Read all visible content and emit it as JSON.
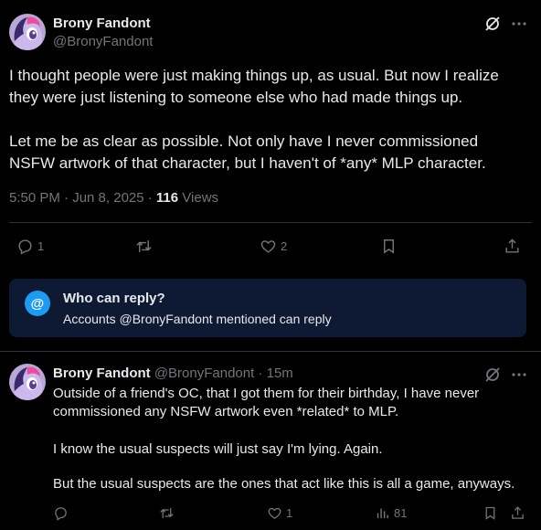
{
  "tweet": {
    "author": "Brony Fandont",
    "handle": "@BronyFandont",
    "paragraph1": "I thought people were just making things up, as usual. But now I realize they were just listening to someone else who had made things up.",
    "paragraph2": "Let me be as clear as possible. Not only have I never commissioned NSFW artwork of that character, but I haven't of *any* MLP character.",
    "time": "5:50 PM · Jun 8, 2025 · ",
    "views_count": "116",
    "views_label": " Views",
    "replies": "1",
    "likes": "2"
  },
  "who_can_reply": {
    "at_symbol": "@",
    "title": "Who can reply?",
    "subtitle": "Accounts @BronyFandont mentioned can reply"
  },
  "reply": {
    "author": "Brony Fandont",
    "handle_time": "@BronyFandont · 15m",
    "highlighted_text": "Outside of a friend's OC, that I got them for their birthday, I have never commissioned any NSFW artwork even *related* to MLP.",
    "paragraph2": "I know the usual suspects will just say I'm lying. Again.",
    "paragraph3": "But the usual suspects are the ones that act like this is all a game, anyways.",
    "likes": "1",
    "views": "81"
  },
  "colors": {
    "background": "#000000",
    "accent": "#1d9bf0",
    "highlight": "#ffff00",
    "secondary_text": "#71767b"
  }
}
